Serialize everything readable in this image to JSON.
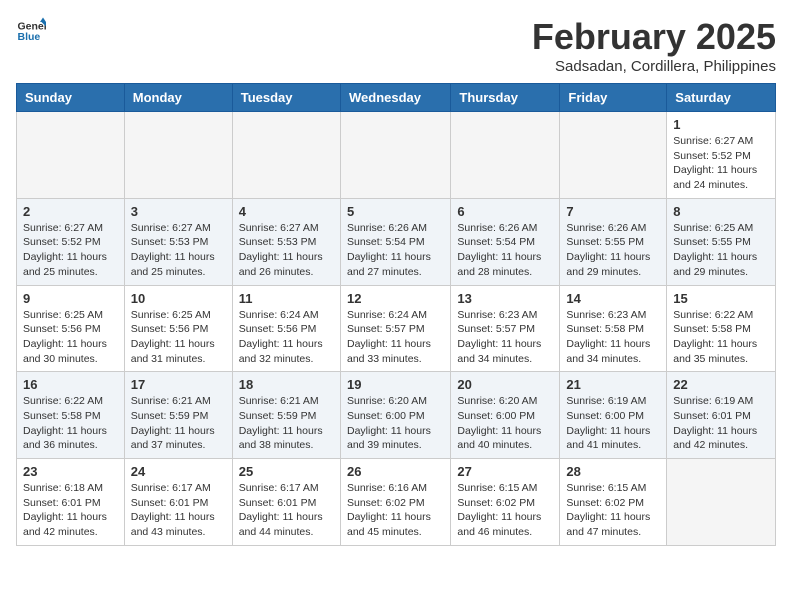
{
  "logo": {
    "general": "General",
    "blue": "Blue"
  },
  "title": {
    "month": "February 2025",
    "location": "Sadsadan, Cordillera, Philippines"
  },
  "weekdays": [
    "Sunday",
    "Monday",
    "Tuesday",
    "Wednesday",
    "Thursday",
    "Friday",
    "Saturday"
  ],
  "weeks": [
    [
      {
        "day": "",
        "info": ""
      },
      {
        "day": "",
        "info": ""
      },
      {
        "day": "",
        "info": ""
      },
      {
        "day": "",
        "info": ""
      },
      {
        "day": "",
        "info": ""
      },
      {
        "day": "",
        "info": ""
      },
      {
        "day": "1",
        "info": "Sunrise: 6:27 AM\nSunset: 5:52 PM\nDaylight: 11 hours and 24 minutes."
      }
    ],
    [
      {
        "day": "2",
        "info": "Sunrise: 6:27 AM\nSunset: 5:52 PM\nDaylight: 11 hours and 25 minutes."
      },
      {
        "day": "3",
        "info": "Sunrise: 6:27 AM\nSunset: 5:53 PM\nDaylight: 11 hours and 25 minutes."
      },
      {
        "day": "4",
        "info": "Sunrise: 6:27 AM\nSunset: 5:53 PM\nDaylight: 11 hours and 26 minutes."
      },
      {
        "day": "5",
        "info": "Sunrise: 6:26 AM\nSunset: 5:54 PM\nDaylight: 11 hours and 27 minutes."
      },
      {
        "day": "6",
        "info": "Sunrise: 6:26 AM\nSunset: 5:54 PM\nDaylight: 11 hours and 28 minutes."
      },
      {
        "day": "7",
        "info": "Sunrise: 6:26 AM\nSunset: 5:55 PM\nDaylight: 11 hours and 29 minutes."
      },
      {
        "day": "8",
        "info": "Sunrise: 6:25 AM\nSunset: 5:55 PM\nDaylight: 11 hours and 29 minutes."
      }
    ],
    [
      {
        "day": "9",
        "info": "Sunrise: 6:25 AM\nSunset: 5:56 PM\nDaylight: 11 hours and 30 minutes."
      },
      {
        "day": "10",
        "info": "Sunrise: 6:25 AM\nSunset: 5:56 PM\nDaylight: 11 hours and 31 minutes."
      },
      {
        "day": "11",
        "info": "Sunrise: 6:24 AM\nSunset: 5:56 PM\nDaylight: 11 hours and 32 minutes."
      },
      {
        "day": "12",
        "info": "Sunrise: 6:24 AM\nSunset: 5:57 PM\nDaylight: 11 hours and 33 minutes."
      },
      {
        "day": "13",
        "info": "Sunrise: 6:23 AM\nSunset: 5:57 PM\nDaylight: 11 hours and 34 minutes."
      },
      {
        "day": "14",
        "info": "Sunrise: 6:23 AM\nSunset: 5:58 PM\nDaylight: 11 hours and 34 minutes."
      },
      {
        "day": "15",
        "info": "Sunrise: 6:22 AM\nSunset: 5:58 PM\nDaylight: 11 hours and 35 minutes."
      }
    ],
    [
      {
        "day": "16",
        "info": "Sunrise: 6:22 AM\nSunset: 5:58 PM\nDaylight: 11 hours and 36 minutes."
      },
      {
        "day": "17",
        "info": "Sunrise: 6:21 AM\nSunset: 5:59 PM\nDaylight: 11 hours and 37 minutes."
      },
      {
        "day": "18",
        "info": "Sunrise: 6:21 AM\nSunset: 5:59 PM\nDaylight: 11 hours and 38 minutes."
      },
      {
        "day": "19",
        "info": "Sunrise: 6:20 AM\nSunset: 6:00 PM\nDaylight: 11 hours and 39 minutes."
      },
      {
        "day": "20",
        "info": "Sunrise: 6:20 AM\nSunset: 6:00 PM\nDaylight: 11 hours and 40 minutes."
      },
      {
        "day": "21",
        "info": "Sunrise: 6:19 AM\nSunset: 6:00 PM\nDaylight: 11 hours and 41 minutes."
      },
      {
        "day": "22",
        "info": "Sunrise: 6:19 AM\nSunset: 6:01 PM\nDaylight: 11 hours and 42 minutes."
      }
    ],
    [
      {
        "day": "23",
        "info": "Sunrise: 6:18 AM\nSunset: 6:01 PM\nDaylight: 11 hours and 42 minutes."
      },
      {
        "day": "24",
        "info": "Sunrise: 6:17 AM\nSunset: 6:01 PM\nDaylight: 11 hours and 43 minutes."
      },
      {
        "day": "25",
        "info": "Sunrise: 6:17 AM\nSunset: 6:01 PM\nDaylight: 11 hours and 44 minutes."
      },
      {
        "day": "26",
        "info": "Sunrise: 6:16 AM\nSunset: 6:02 PM\nDaylight: 11 hours and 45 minutes."
      },
      {
        "day": "27",
        "info": "Sunrise: 6:15 AM\nSunset: 6:02 PM\nDaylight: 11 hours and 46 minutes."
      },
      {
        "day": "28",
        "info": "Sunrise: 6:15 AM\nSunset: 6:02 PM\nDaylight: 11 hours and 47 minutes."
      },
      {
        "day": "",
        "info": ""
      }
    ]
  ]
}
